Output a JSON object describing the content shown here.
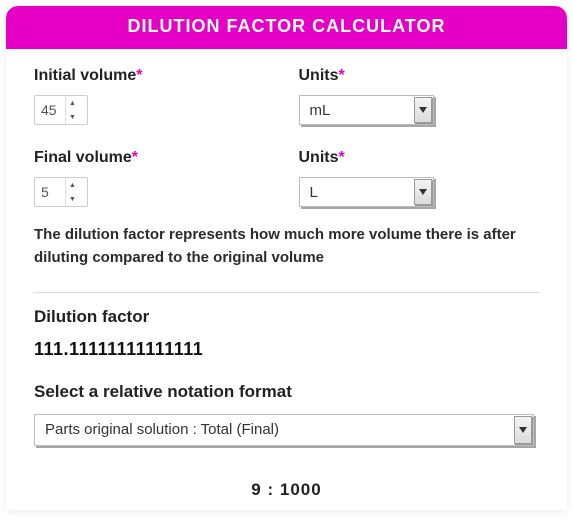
{
  "header": {
    "title": "DILUTION FACTOR CALCULATOR"
  },
  "fields": {
    "initial_volume": {
      "label": "Initial volume",
      "value": "45"
    },
    "initial_units": {
      "label": "Units",
      "value": "mL"
    },
    "final_volume": {
      "label": "Final volume",
      "value": "5"
    },
    "final_units": {
      "label": "Units",
      "value": "L"
    }
  },
  "required_marker": "*",
  "description": "The dilution factor represents how much more volume there is after diluting compared to the original volume",
  "dilution_factor": {
    "label": "Dilution factor",
    "value": "111.11111111111111"
  },
  "notation": {
    "label": "Select a relative notation format",
    "value": "Parts original solution : Total (Final)"
  },
  "ratio_result": "9 : 1000"
}
